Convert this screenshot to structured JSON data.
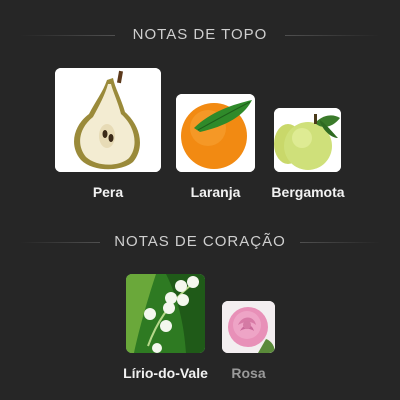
{
  "sections": {
    "top": {
      "title": "NOTAS DE TOPO",
      "notes": [
        {
          "label": "Pera",
          "icon": "pear-icon"
        },
        {
          "label": "Laranja",
          "icon": "orange-icon"
        },
        {
          "label": "Bergamota",
          "icon": "bergamot-icon"
        }
      ]
    },
    "heart": {
      "title": "NOTAS DE CORAÇÃO",
      "notes": [
        {
          "label": "Lírio-do-Vale",
          "icon": "lily-of-the-valley-icon"
        },
        {
          "label": "Rosa",
          "icon": "rose-icon"
        }
      ]
    }
  },
  "colors": {
    "background": "#262626",
    "title": "#cfcfcf",
    "label": "#f2f2f2",
    "label_dim": "#9a9a9a"
  }
}
